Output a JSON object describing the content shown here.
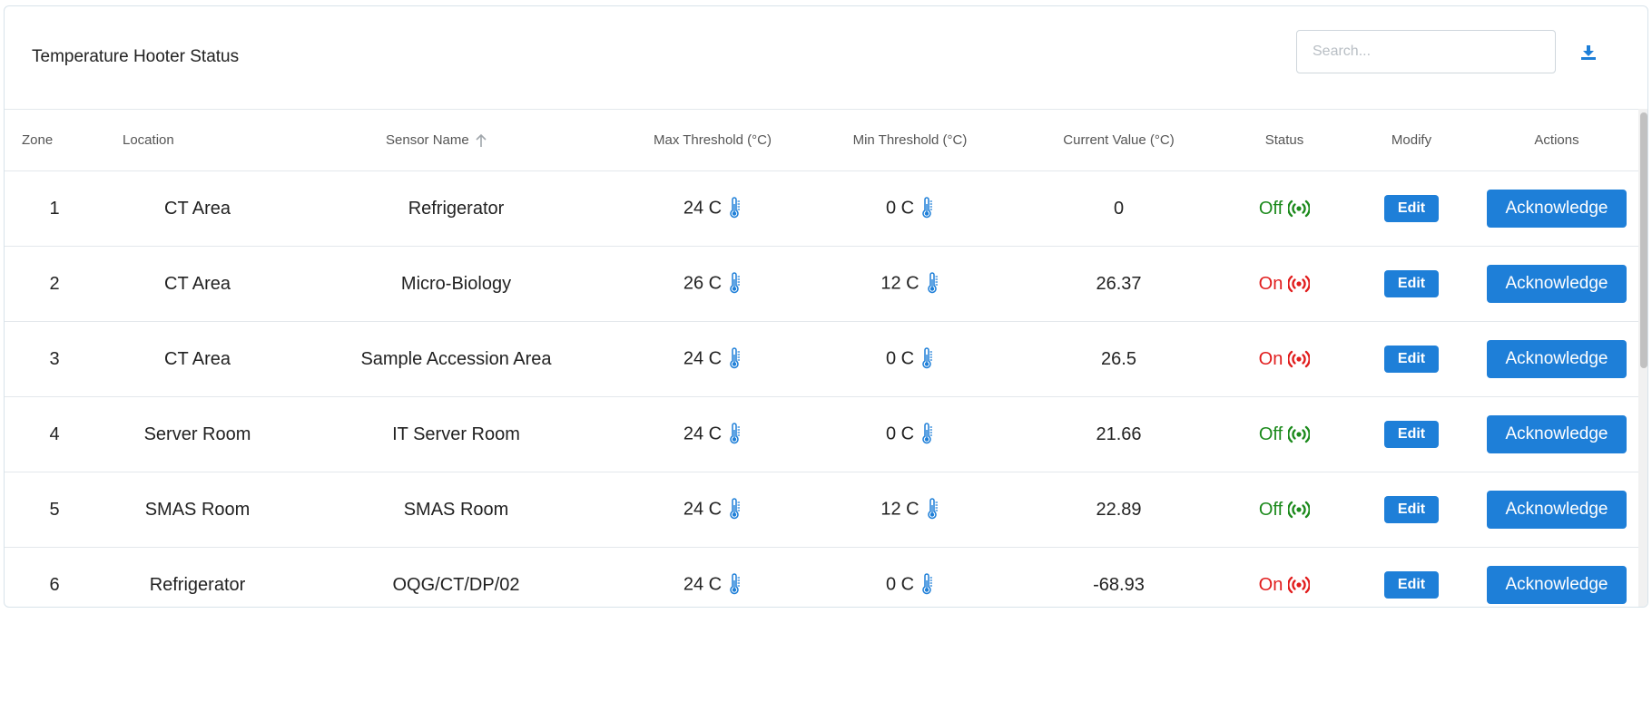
{
  "header": {
    "title": "Temperature Hooter Status",
    "search_placeholder": "Search...",
    "download_icon": "download-icon"
  },
  "table": {
    "columns": [
      "Zone",
      "Location",
      "Sensor Name",
      "Max Threshold (°C)",
      "Min Threshold (°C)",
      "Current Value (°C)",
      "Status",
      "Modify",
      "Actions"
    ],
    "sorted_column": "Sensor Name",
    "sort_direction": "ascending",
    "rows": [
      {
        "zone": "1",
        "location": "CT Area",
        "sensor": "Refrigerator",
        "max": "24 C",
        "min": "0 C",
        "current": "0",
        "status": "Off",
        "edit": "Edit",
        "action": "Acknowledge"
      },
      {
        "zone": "2",
        "location": "CT Area",
        "sensor": "Micro-Biology",
        "max": "26 C",
        "min": "12 C",
        "current": "26.37",
        "status": "On",
        "edit": "Edit",
        "action": "Acknowledge"
      },
      {
        "zone": "3",
        "location": "CT Area",
        "sensor": "Sample Accession Area",
        "max": "24 C",
        "min": "0 C",
        "current": "26.5",
        "status": "On",
        "edit": "Edit",
        "action": "Acknowledge"
      },
      {
        "zone": "4",
        "location": "Server Room",
        "sensor": "IT Server Room",
        "max": "24 C",
        "min": "0 C",
        "current": "21.66",
        "status": "Off",
        "edit": "Edit",
        "action": "Acknowledge"
      },
      {
        "zone": "5",
        "location": "SMAS Room",
        "sensor": "SMAS Room",
        "max": "24 C",
        "min": "12 C",
        "current": "22.89",
        "status": "Off",
        "edit": "Edit",
        "action": "Acknowledge"
      },
      {
        "zone": "6",
        "location": "Refrigerator",
        "sensor": "OQG/CT/DP/02",
        "max": "24 C",
        "min": "0 C",
        "current": "-68.93",
        "status": "On",
        "edit": "Edit",
        "action": "Acknowledge"
      }
    ]
  },
  "colors": {
    "accent": "#1e7fd8",
    "status_on": "#e11d1d",
    "status_off": "#1c8a1c",
    "thermometer": "#1e7fd8"
  },
  "icons": {
    "thermometer": "thermometer-icon",
    "status": "broadcast-icon",
    "sort": "arrow-up-icon"
  }
}
